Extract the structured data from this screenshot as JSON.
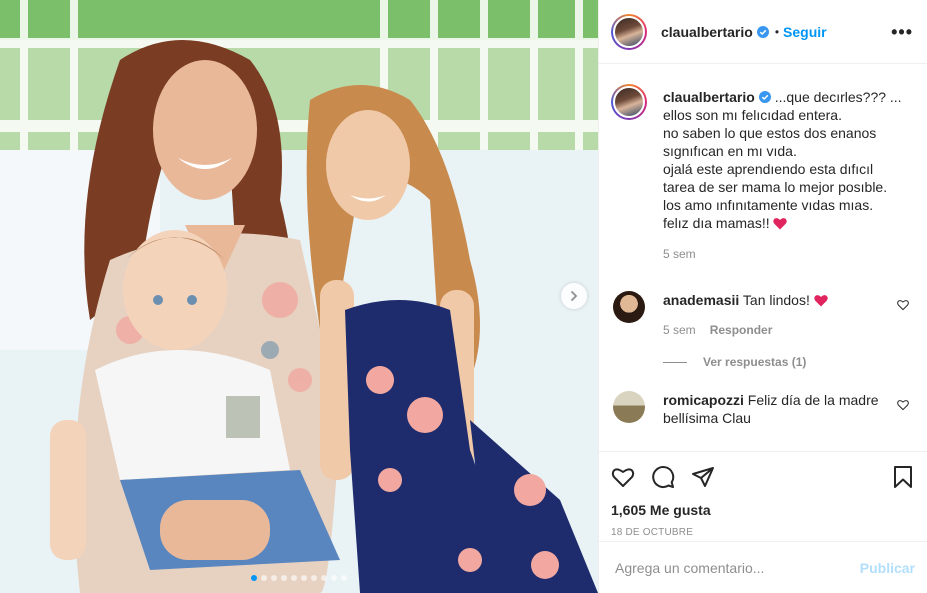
{
  "post": {
    "username": "claualbertario",
    "dot": "•",
    "follow_label": "Seguir",
    "more_label": "•••",
    "photo_dots": 10,
    "active_dot": 0
  },
  "caption": {
    "username": "claualbertario",
    "text": "...que decırles??? ...\nellos son mı felıcıdad entera.\nno saben lo que estos dos enanos\nsıgnıfıcan en mı vıda.\nojalá este aprendıendo esta dıfıcıl\ntarea de ser mama lo mejor posıble.\nlos amo ınfınıtamente vıdas mıas.\nfelız dıa mamas!!",
    "time": "5 sem"
  },
  "comments": [
    {
      "username": "anademasii",
      "text": "Tan lindos!",
      "time": "5 sem",
      "reply_label": "Responder",
      "view_replies": "Ver respuestas (1)"
    },
    {
      "username": "romicapozzi",
      "text": "Feliz día de la madre bellísima Clau"
    }
  ],
  "actions": {
    "likes": "1,605 Me gusta",
    "date": "18 DE OCTUBRE"
  },
  "add_comment": {
    "placeholder": "Agrega un comentario...",
    "publish_label": "Publicar"
  },
  "colors": {
    "accent": "#0095f6",
    "publish_disabled": "#b2dffc",
    "heart": "#e0245e",
    "muted": "#8e8e8e"
  },
  "icons": [
    "verified-badge-icon",
    "more-options-icon",
    "chevron-right-icon",
    "heart-outline-icon",
    "comment-icon",
    "share-icon",
    "bookmark-icon",
    "red-heart-emoji"
  ]
}
